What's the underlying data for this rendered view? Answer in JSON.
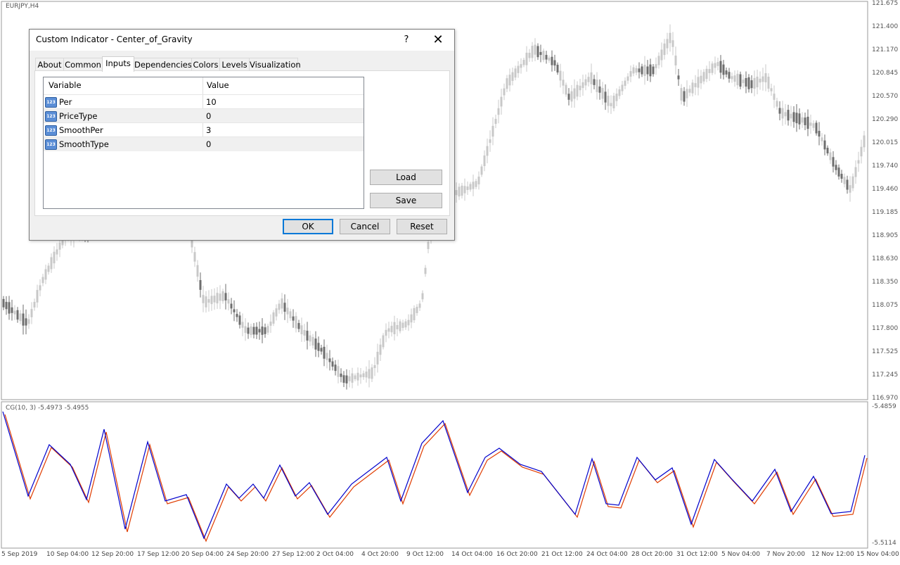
{
  "chart": {
    "symbol": "EURJPY,H4",
    "indicator_label": "CG(10, 3) -5.4973 -5.4955",
    "price_axis": [
      "121.675",
      "121.400",
      "121.170",
      "120.845",
      "120.570",
      "120.290",
      "120.015",
      "119.740",
      "119.460",
      "119.185",
      "118.905",
      "118.630",
      "118.350",
      "118.075",
      "117.800",
      "117.525",
      "117.245",
      "116.970"
    ],
    "indicator_axis": [
      "-5.4859",
      "-5.5114"
    ],
    "time_axis": [
      "5 Sep 2019",
      "10 Sep 04:00",
      "12 Sep 20:00",
      "17 Sep 12:00",
      "20 Sep 04:00",
      "24 Sep 20:00",
      "27 Sep 12:00",
      "2 Oct 04:00",
      "4 Oct 20:00",
      "9 Oct 12:00",
      "14 Oct 04:00",
      "16 Oct 20:00",
      "21 Oct 12:00",
      "24 Oct 04:00",
      "28 Oct 20:00",
      "31 Oct 12:00",
      "5 Nov 04:00",
      "7 Nov 20:00",
      "12 Nov 12:00",
      "15 Nov 04:00"
    ],
    "colors": {
      "bull": "#c8c8c8",
      "bear": "#6e6e6e",
      "line1": "#0000cc",
      "line2": "#e03c00"
    }
  },
  "dialog": {
    "title": "Custom Indicator - Center_of_Gravity",
    "help": "?",
    "close": "✕",
    "tabs": [
      "About",
      "Common",
      "Inputs",
      "Dependencies",
      "Colors",
      "Levels",
      "Visualization"
    ],
    "active_tab": "Inputs",
    "grid": {
      "headers": {
        "variable": "Variable",
        "value": "Value"
      },
      "icon": "123",
      "rows": [
        {
          "name": "Per",
          "value": "10"
        },
        {
          "name": "PriceType",
          "value": "0"
        },
        {
          "name": "SmoothPer",
          "value": "3"
        },
        {
          "name": "SmoothType",
          "value": "0"
        }
      ]
    },
    "buttons": {
      "load": "Load",
      "save": "Save",
      "ok": "OK",
      "cancel": "Cancel",
      "reset": "Reset"
    }
  }
}
